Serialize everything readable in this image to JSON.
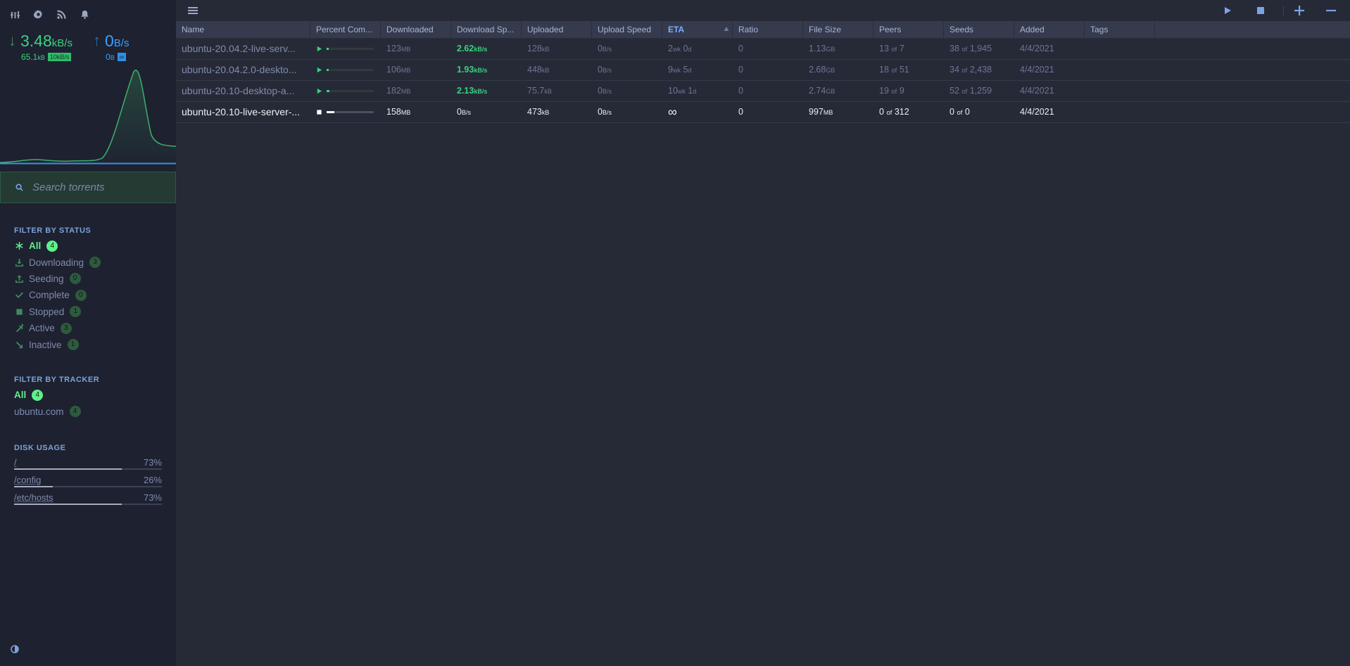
{
  "speeds": {
    "download": {
      "value": "3.48",
      "unit": "kB/s",
      "total": "65.1",
      "total_unit": "kB",
      "limit": "10kB/s"
    },
    "upload": {
      "value": "0",
      "unit": "B/s",
      "total": "0",
      "total_unit": "B",
      "limit": "∞"
    }
  },
  "colors": {
    "download": "#39d17f",
    "upload": "#3aa0ff",
    "accent": "#5ef08a",
    "sidebar_bg": "#1e2130",
    "main_bg": "#262a37",
    "header_bg": "#353a4d"
  },
  "search": {
    "placeholder": "Search torrents"
  },
  "status_filters": {
    "title": "FILTER BY STATUS",
    "items": [
      {
        "label": "All",
        "count": "4",
        "icon": "asterisk-icon",
        "active": true
      },
      {
        "label": "Downloading",
        "count": "3",
        "icon": "download-icon"
      },
      {
        "label": "Seeding",
        "count": "0",
        "icon": "upload-icon"
      },
      {
        "label": "Complete",
        "count": "0",
        "icon": "checkmark-icon"
      },
      {
        "label": "Stopped",
        "count": "1",
        "icon": "stop-icon"
      },
      {
        "label": "Active",
        "count": "3",
        "icon": "active-arrows-icon"
      },
      {
        "label": "Inactive",
        "count": "1",
        "icon": "inactive-icon"
      }
    ]
  },
  "tracker_filters": {
    "title": "FILTER BY TRACKER",
    "items": [
      {
        "label": "All",
        "count": "4",
        "active": true
      },
      {
        "label": "ubuntu.com",
        "count": "4"
      }
    ]
  },
  "disk_usage": {
    "title": "DISK USAGE",
    "items": [
      {
        "path": "/",
        "percent": "73%",
        "fraction": 0.73
      },
      {
        "path": "/config",
        "percent": "26%",
        "fraction": 0.26
      },
      {
        "path": "/etc/hosts",
        "percent": "73%",
        "fraction": 0.73
      }
    ]
  },
  "table": {
    "columns": [
      "Name",
      "Percent Com...",
      "Downloaded",
      "Download Sp...",
      "Uploaded",
      "Upload Speed",
      "ETA",
      "Ratio",
      "File Size",
      "Peers",
      "Seeds",
      "Added",
      "Tags"
    ],
    "sorted_column": "ETA",
    "rows": [
      {
        "name": "ubuntu-20.04.2-live-serv...",
        "state": "downloading",
        "progress": 0.05,
        "downloaded": "123",
        "downloaded_unit": "MB",
        "dl_speed": "2.62",
        "dl_speed_unit": "kB/s",
        "uploaded": "128",
        "uploaded_unit": "kB",
        "ul_speed": "0",
        "ul_speed_unit": "B/s",
        "eta_a": "2",
        "eta_a_unit": "wk",
        "eta_b": "0",
        "eta_b_unit": "d",
        "ratio": "0",
        "size": "1.13",
        "size_unit": "GB",
        "peers_a": "13",
        "peers_b": "7",
        "seeds_a": "38",
        "seeds_b": "1,945",
        "added": "4/4/2021"
      },
      {
        "name": "ubuntu-20.04.2.0-deskto...",
        "state": "downloading",
        "progress": 0.04,
        "downloaded": "106",
        "downloaded_unit": "MB",
        "dl_speed": "1.93",
        "dl_speed_unit": "kB/s",
        "uploaded": "448",
        "uploaded_unit": "kB",
        "ul_speed": "0",
        "ul_speed_unit": "B/s",
        "eta_a": "9",
        "eta_a_unit": "wk",
        "eta_b": "5",
        "eta_b_unit": "d",
        "ratio": "0",
        "size": "2.68",
        "size_unit": "GB",
        "peers_a": "18",
        "peers_b": "51",
        "seeds_a": "34",
        "seeds_b": "2,438",
        "added": "4/4/2021"
      },
      {
        "name": "ubuntu-20.10-desktop-a...",
        "state": "downloading",
        "progress": 0.06,
        "downloaded": "182",
        "downloaded_unit": "MB",
        "dl_speed": "2.13",
        "dl_speed_unit": "kB/s",
        "uploaded": "75.7",
        "uploaded_unit": "kB",
        "ul_speed": "0",
        "ul_speed_unit": "B/s",
        "eta_a": "10",
        "eta_a_unit": "wk",
        "eta_b": "1",
        "eta_b_unit": "d",
        "ratio": "0",
        "size": "2.74",
        "size_unit": "GB",
        "peers_a": "19",
        "peers_b": "9",
        "seeds_a": "52",
        "seeds_b": "1,259",
        "added": "4/4/2021"
      },
      {
        "name": "ubuntu-20.10-live-server-...",
        "state": "stopped",
        "progress": 0.16,
        "downloaded": "158",
        "downloaded_unit": "MB",
        "dl_speed": "0",
        "dl_speed_unit": "B/s",
        "uploaded": "473",
        "uploaded_unit": "kB",
        "ul_speed": "0",
        "ul_speed_unit": "B/s",
        "eta_inf": "∞",
        "ratio": "0",
        "size": "997",
        "size_unit": "MB",
        "peers_a": "0",
        "peers_b": "312",
        "seeds_a": "0",
        "seeds_b": "0",
        "added": "4/4/2021"
      }
    ],
    "of_word": "of"
  }
}
